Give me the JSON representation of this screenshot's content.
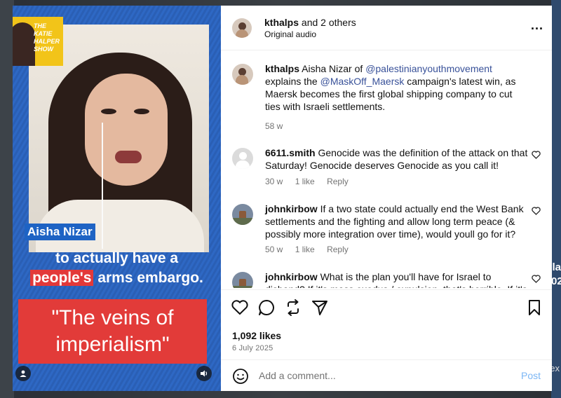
{
  "video": {
    "show_logo": "THE KATIE HALPER SHOW",
    "name_tag": "Aisha Nizar",
    "caption_line1": "to actually have a",
    "caption_highlight": "people's",
    "caption_line2_rest": "arms embargo.",
    "quote_line1": "\"The veins of",
    "quote_line2": "imperialism\"",
    "user_icon": "person-icon",
    "sound_icon": "speaker-icon"
  },
  "header": {
    "username": "kthalps",
    "and_others": "and 2 others",
    "audio": "Original audio",
    "more": "..."
  },
  "caption": {
    "username": "kthalps",
    "text_1": "Aisha Nizar of",
    "mention_1": "@palestinianyouthmovement",
    "text_2": "explains the",
    "mention_2": "@MaskOff_Maersk",
    "text_3": "campaign's latest win, as Maersk becomes the first global shipping company to cut ties with Israeli settlements.",
    "age": "58 w"
  },
  "comments": [
    {
      "username": "6611.smith",
      "text": "Genocide was the definition of the attack on that Saturday! Genocide deserves Genocide as you call it!",
      "age": "30 w",
      "likes": "1 like",
      "reply": "Reply"
    },
    {
      "username": "johnkirbow",
      "text": "If a two state could actually end the West Bank settlements and the fighting and allow long term peace (& possibly more integration over time), would youll go for it?",
      "age": "50 w",
      "likes": "1 like",
      "reply": "Reply"
    },
    {
      "username": "johnkirbow",
      "text": "What is the plan you'll have for Israel to disband? If it's mass exodus / expulsion, that's horrible. If it's a one state,"
    }
  ],
  "stats": {
    "likes": "1,092 likes",
    "date": "6 July 2025"
  },
  "add_comment": {
    "placeholder": "Add a comment...",
    "post": "Post"
  },
  "backdrop": {
    "right_fragment": "la 02",
    "right_bottom": "ex"
  }
}
